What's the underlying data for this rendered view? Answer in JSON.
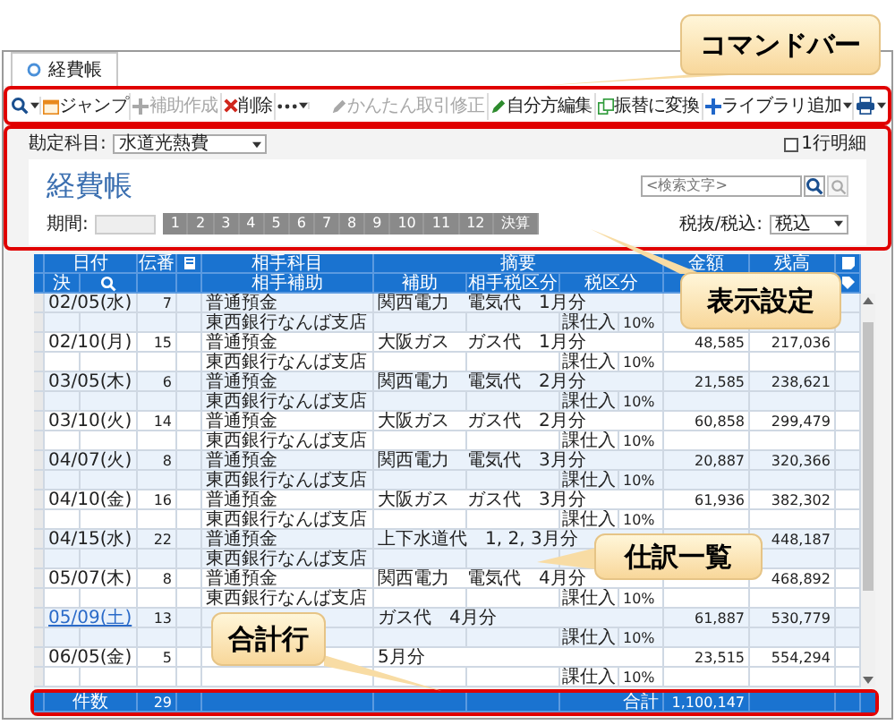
{
  "tab": {
    "label": "経費帳",
    "selected": true
  },
  "toolbar": [
    {
      "kind": "search",
      "menu": true
    },
    {
      "kind": "calendar",
      "label": "ジャンプ",
      "disabled": false,
      "menu": false
    },
    {
      "kind": "plus",
      "label": "補助作成",
      "disabled": true,
      "menu": false
    },
    {
      "kind": "delete",
      "label": "削除",
      "disabled": false,
      "menu": false
    },
    {
      "kind": "more",
      "menu": true
    },
    {
      "kind": "spacer"
    },
    {
      "kind": "pencil",
      "label": "かんたん取引修正",
      "disabled": true,
      "menu": false
    },
    {
      "kind": "pencil",
      "label": "自分方編集",
      "disabled": false,
      "menu": false
    },
    {
      "kind": "copy",
      "label": "振替に変換",
      "disabled": false,
      "menu": false
    },
    {
      "kind": "plus",
      "label": "ライブラリ追加",
      "disabled": false,
      "menu": true
    },
    {
      "kind": "print",
      "menu": true
    }
  ],
  "settings": {
    "account_label": "勘定科目:",
    "account_value": "水道光熱費",
    "single_line": {
      "label": "1行明細",
      "checked": false
    },
    "title": "経費帳",
    "search": {
      "placeholder": "<検索文字>"
    },
    "period_label": "期間:",
    "months": [
      "1",
      "2",
      "3",
      "4",
      "5",
      "6",
      "7",
      "8",
      "9",
      "10",
      "11",
      "12",
      "決算"
    ],
    "tax_label": "税抜/税込:",
    "tax_value": "税込"
  },
  "table": {
    "header_top": {
      "date": "日付",
      "number": "伝番",
      "account": "相手科目",
      "summary": "摘要",
      "amount": "金額",
      "balance": "残高"
    },
    "header_bottom": {
      "closing": "決",
      "sub_account": "相手補助",
      "sub": "補助",
      "partner_tax": "相手税区分",
      "tax": "税区分"
    },
    "rows": [
      {
        "date": "02/05(水)",
        "holiday": false,
        "number": "7",
        "account": "普通預金",
        "sub_account": "東西銀行なんば支店",
        "summary": "関西電力　電気代　1月分",
        "tax": "課仕入",
        "rate": "10%"
      },
      {
        "date": "02/10(月)",
        "holiday": false,
        "number": "15",
        "account": "普通預金",
        "sub_account": "東西銀行なんば支店",
        "summary": "大阪ガス　ガス代　1月分",
        "tax": "課仕入",
        "rate": "10%",
        "amount": "48,585",
        "balance": "217,036"
      },
      {
        "date": "03/05(木)",
        "holiday": false,
        "number": "6",
        "account": "普通預金",
        "sub_account": "東西銀行なんば支店",
        "summary": "関西電力　電気代　2月分",
        "tax": "課仕入",
        "rate": "10%",
        "amount": "21,585",
        "balance": "238,621"
      },
      {
        "date": "03/10(火)",
        "holiday": false,
        "number": "14",
        "account": "普通預金",
        "sub_account": "東西銀行なんば支店",
        "summary": "大阪ガス　ガス代　2月分",
        "tax": "課仕入",
        "rate": "10%",
        "amount": "60,858",
        "balance": "299,479"
      },
      {
        "date": "04/07(火)",
        "holiday": false,
        "number": "8",
        "account": "普通預金",
        "sub_account": "東西銀行なんば支店",
        "summary": "関西電力　電気代　3月分",
        "tax": "課仕入",
        "rate": "10%",
        "amount": "20,887",
        "balance": "320,366"
      },
      {
        "date": "04/10(金)",
        "holiday": false,
        "number": "16",
        "account": "普通預金",
        "sub_account": "東西銀行なんば支店",
        "summary": "大阪ガス　ガス代　3月分",
        "tax": "課仕入",
        "rate": "10%",
        "amount": "61,936",
        "balance": "382,302"
      },
      {
        "date": "04/15(水)",
        "holiday": false,
        "number": "22",
        "account": "普通預金",
        "sub_account": "東西銀行なんば支店",
        "summary": "上下水道代　1, 2, 3月分",
        "balance": "448,187"
      },
      {
        "date": "05/07(木)",
        "holiday": false,
        "number": "8",
        "account": "普通預金",
        "sub_account": "東西銀行なんば支店",
        "summary": "関西電力　電気代　4月分",
        "tax": "課仕入",
        "rate": "10%",
        "balance": "468,892"
      },
      {
        "date": "05/09(土)",
        "holiday": true,
        "number": "13",
        "summary": "ガス代　4月分",
        "tax": "課仕入",
        "rate": "10%",
        "amount": "61,887",
        "balance": "530,779"
      },
      {
        "date": "06/05(金)",
        "holiday": false,
        "number": "5",
        "summary": "5月分",
        "tax": "課仕入",
        "rate": "10%",
        "amount": "23,515",
        "balance": "554,294"
      }
    ],
    "total": {
      "count_label": "件数",
      "count": "29",
      "sum_label": "合計",
      "sum": "1,100,147"
    }
  },
  "callouts": [
    "コマンドバー",
    "表示設定",
    "仕訳一覧",
    "合計行"
  ]
}
